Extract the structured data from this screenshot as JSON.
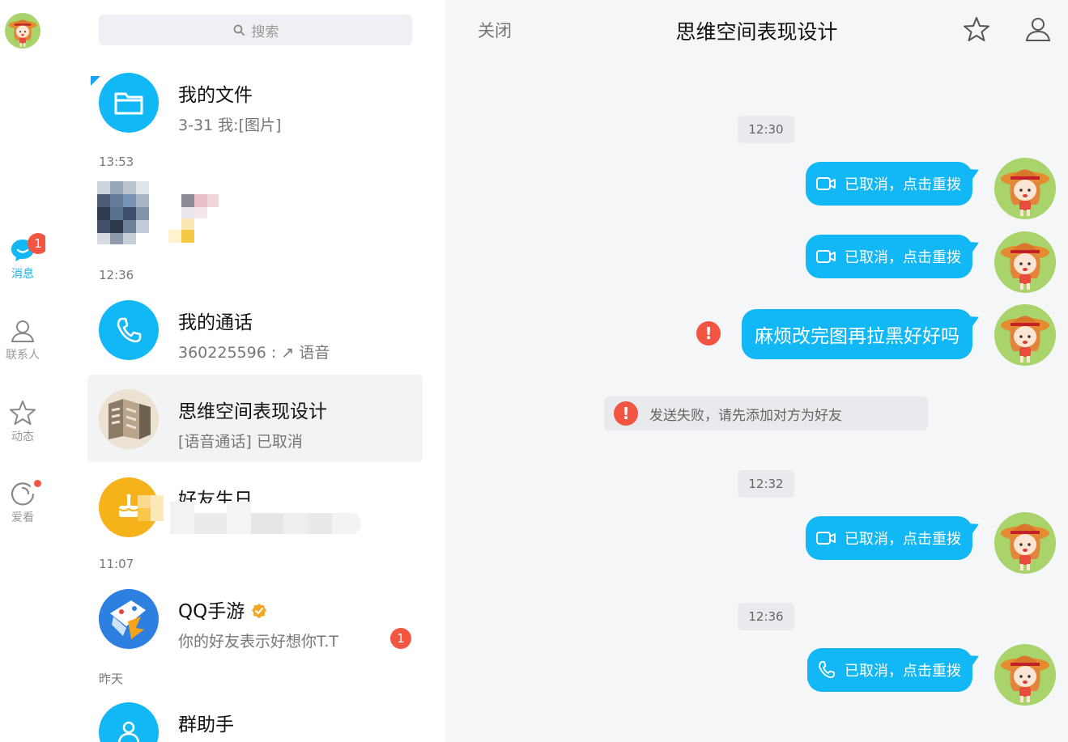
{
  "search": {
    "placeholder": "搜索"
  },
  "nav": {
    "items": [
      {
        "label": "消息",
        "badge": "1",
        "icon": "chat-bubble-icon",
        "active": true
      },
      {
        "label": "联系人",
        "icon": "person-icon"
      },
      {
        "label": "动态",
        "icon": "star-icon"
      },
      {
        "label": "爱看",
        "icon": "swirl-icon",
        "dot": true
      }
    ]
  },
  "conversations": [
    {
      "title": "我的文件",
      "subtitle": "3-31 我:[图片]",
      "icon": "folder-icon"
    },
    {
      "time": "13:53"
    },
    {
      "time": "12:36"
    },
    {
      "title": "我的通话",
      "subtitle": "360225596 : ↗ 语音",
      "icon": "phone-icon"
    },
    {
      "title": "思维空间表现设计",
      "subtitle": "[语音通话] 已取消",
      "selected": true
    },
    {
      "title": "好友生日",
      "icon": "cake-icon"
    },
    {
      "time": "11:07"
    },
    {
      "title": "QQ手游",
      "subtitle": "你的好友表示好想你T.T",
      "badge": "1",
      "icon": "game-icon",
      "verified": true
    },
    {
      "time": "昨天"
    },
    {
      "title": "群助手",
      "icon": "group-icon"
    }
  ],
  "chat": {
    "close_label": "关闭",
    "title": "思维空间表现设计",
    "messages": [
      {
        "time": "12:30"
      },
      {
        "text": "已取消，点击重拨",
        "icon": "video-call-icon"
      },
      {
        "text": "已取消，点击重拨",
        "icon": "video-call-icon"
      },
      {
        "text": "麻烦改完图再拉黑好好吗",
        "failed": true
      },
      {
        "notice": "发送失败，请先添加对方为好友"
      },
      {
        "time": "12:32"
      },
      {
        "text": "已取消，点击重拨",
        "icon": "video-call-icon"
      },
      {
        "time": "12:36"
      },
      {
        "text": "已取消，点击重拨",
        "icon": "phone-icon"
      }
    ],
    "error_mark": "!"
  },
  "colors": {
    "accent": "#12b7f5",
    "badge": "#f25643",
    "chat_bg": "#f5f6f8"
  }
}
